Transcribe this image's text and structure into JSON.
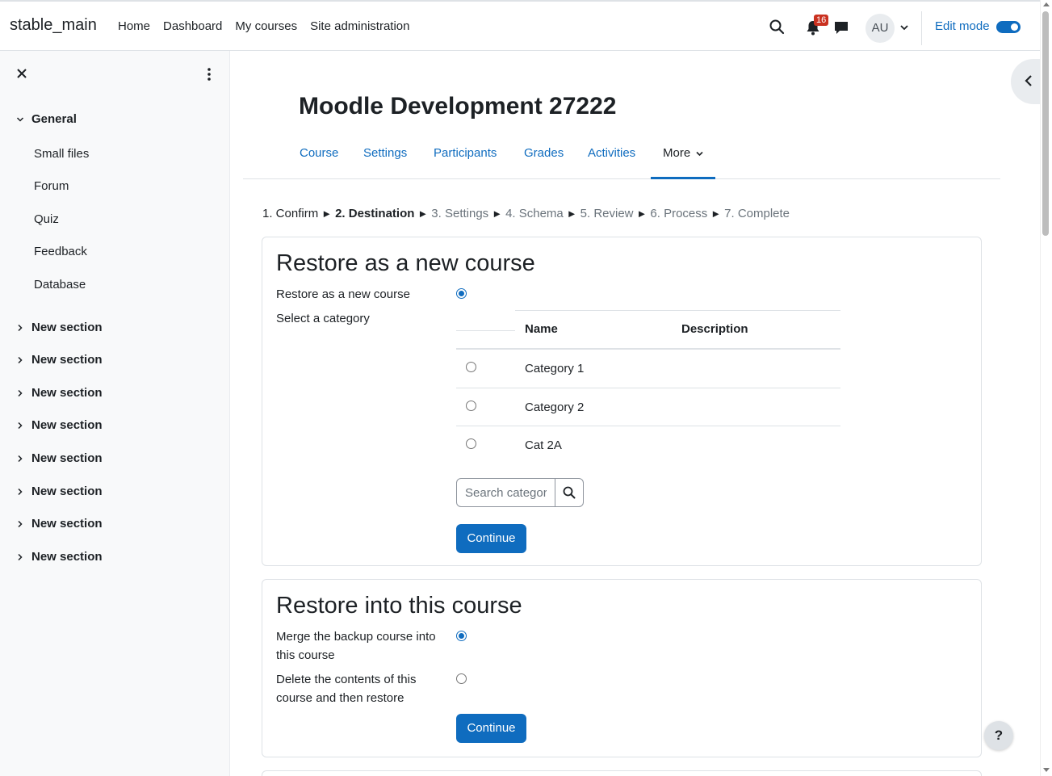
{
  "navbar": {
    "brand": "stable_main",
    "links": [
      "Home",
      "Dashboard",
      "My courses",
      "Site administration"
    ],
    "notification_count": "16",
    "avatar_initials": "AU",
    "edit_mode_label": "Edit mode",
    "edit_mode_on": true
  },
  "drawer": {
    "sections": [
      {
        "label": "General",
        "expanded": true,
        "items": [
          "Small files",
          "Forum",
          "Quiz",
          "Feedback",
          "Database"
        ]
      },
      {
        "label": "New section",
        "expanded": false
      },
      {
        "label": "New section",
        "expanded": false
      },
      {
        "label": "New section",
        "expanded": false
      },
      {
        "label": "New section",
        "expanded": false
      },
      {
        "label": "New section",
        "expanded": false
      },
      {
        "label": "New section",
        "expanded": false
      },
      {
        "label": "New section",
        "expanded": false
      },
      {
        "label": "New section",
        "expanded": false
      }
    ]
  },
  "page": {
    "title": "Moodle Development 27222",
    "tabs": [
      "Course",
      "Settings",
      "Participants",
      "Grades",
      "Activities"
    ],
    "more_tab": "More"
  },
  "steps": {
    "items": [
      "1. Confirm",
      "2. Destination",
      "3. Settings",
      "4. Schema",
      "5. Review",
      "6. Process",
      "7. Complete"
    ],
    "separator": "►"
  },
  "new_course": {
    "heading": "Restore as a new course",
    "radio_label": "Restore as a new course",
    "category_label": "Select a category",
    "columns": [
      "Name",
      "Description"
    ],
    "categories": [
      "Category 1",
      "Category 2",
      "Cat 2A"
    ],
    "search_placeholder": "Search categories",
    "continue": "Continue"
  },
  "this_course": {
    "heading": "Restore into this course",
    "merge_label": "Merge the backup course into this course",
    "delete_label": "Delete the contents of this course and then restore",
    "continue": "Continue"
  },
  "help": "?",
  "colors": {
    "primary": "#0f6cbf",
    "badge": "#ca3120"
  }
}
